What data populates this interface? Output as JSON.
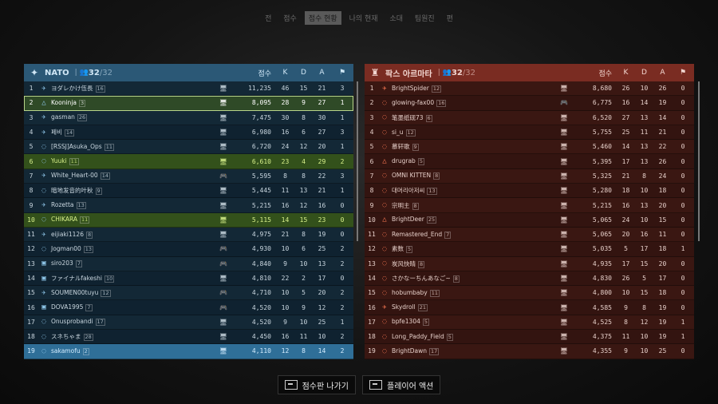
{
  "topnav": [
    "전",
    "점수",
    "점수 현황",
    "나의 현재",
    "소대",
    "팀원진",
    "편"
  ],
  "topnav_active": 2,
  "columns": {
    "score": "점수",
    "k": "K",
    "d": "D",
    "a": "A",
    "flag": "⚑"
  },
  "nato": {
    "name": "NATO",
    "count": "32",
    "max": "/32",
    "players": [
      {
        "idx": "1",
        "cls": "✈",
        "name": "ヨダレかけ伍長",
        "lvl": "16",
        "plat": "pc",
        "score": "11,235",
        "k": "46",
        "d": "15",
        "a": "21",
        "flag": "3"
      },
      {
        "idx": "2",
        "cls": "△",
        "name": "Kooninja",
        "lvl": "3",
        "plat": "pc",
        "score": "8,095",
        "k": "28",
        "d": "9",
        "a": "27",
        "flag": "1",
        "state": "me"
      },
      {
        "idx": "3",
        "cls": "✈",
        "name": "gasman",
        "lvl": "26",
        "plat": "pc",
        "score": "7,475",
        "k": "30",
        "d": "8",
        "a": "30",
        "flag": "1"
      },
      {
        "idx": "4",
        "cls": "✈",
        "name": "페비",
        "lvl": "14",
        "plat": "pc",
        "score": "6,980",
        "k": "16",
        "d": "6",
        "a": "27",
        "flag": "3"
      },
      {
        "idx": "5",
        "cls": "◌",
        "name": "[RSSJ]Asuka_Ops",
        "lvl": "11",
        "plat": "pc",
        "score": "6,720",
        "k": "24",
        "d": "12",
        "a": "20",
        "flag": "1"
      },
      {
        "idx": "6",
        "cls": "◌",
        "name": "Yuuki",
        "lvl": "11",
        "plat": "pc",
        "score": "6,610",
        "k": "23",
        "d": "4",
        "a": "29",
        "flag": "2",
        "state": "squad"
      },
      {
        "idx": "7",
        "cls": "✈",
        "name": "White_Heart-00",
        "lvl": "14",
        "plat": "pad",
        "score": "5,595",
        "k": "8",
        "d": "8",
        "a": "22",
        "flag": "3"
      },
      {
        "idx": "8",
        "cls": "◌",
        "name": "暗地发音的叶秋",
        "lvl": "9",
        "plat": "pc",
        "score": "5,445",
        "k": "11",
        "d": "13",
        "a": "21",
        "flag": "1"
      },
      {
        "idx": "9",
        "cls": "✈",
        "name": "Rozetta",
        "lvl": "13",
        "plat": "pc",
        "score": "5,215",
        "k": "16",
        "d": "12",
        "a": "16",
        "flag": "0"
      },
      {
        "idx": "10",
        "cls": "◌",
        "name": "CHIKARA",
        "lvl": "11",
        "plat": "pc",
        "score": "5,115",
        "k": "14",
        "d": "15",
        "a": "23",
        "flag": "0",
        "state": "squad"
      },
      {
        "idx": "11",
        "cls": "✈",
        "name": "eijiaki1126",
        "lvl": "8",
        "plat": "pc",
        "score": "4,975",
        "k": "21",
        "d": "8",
        "a": "19",
        "flag": "0"
      },
      {
        "idx": "12",
        "cls": "◌",
        "name": "Jogman00",
        "lvl": "13",
        "plat": "pad",
        "score": "4,930",
        "k": "10",
        "d": "6",
        "a": "25",
        "flag": "2"
      },
      {
        "idx": "13",
        "cls": "▣",
        "name": "siro203",
        "lvl": "7",
        "plat": "pad",
        "score": "4,840",
        "k": "9",
        "d": "10",
        "a": "13",
        "flag": "2"
      },
      {
        "idx": "14",
        "cls": "▣",
        "name": "ファイナルfakeshi",
        "lvl": "10",
        "plat": "pc",
        "score": "4,810",
        "k": "22",
        "d": "2",
        "a": "17",
        "flag": "0"
      },
      {
        "idx": "15",
        "cls": "✈",
        "name": "SOUMEN00tuyu",
        "lvl": "12",
        "plat": "pad",
        "score": "4,710",
        "k": "10",
        "d": "5",
        "a": "20",
        "flag": "2"
      },
      {
        "idx": "16",
        "cls": "▣",
        "name": "DOVA1995",
        "lvl": "7",
        "plat": "pad",
        "score": "4,520",
        "k": "10",
        "d": "9",
        "a": "12",
        "flag": "2"
      },
      {
        "idx": "17",
        "cls": "◌",
        "name": "Onusprobandi",
        "lvl": "17",
        "plat": "pc",
        "score": "4,520",
        "k": "9",
        "d": "10",
        "a": "25",
        "flag": "1"
      },
      {
        "idx": "18",
        "cls": "◌",
        "name": "スネちゃま",
        "lvl": "28",
        "plat": "pc",
        "score": "4,450",
        "k": "16",
        "d": "11",
        "a": "10",
        "flag": "2"
      },
      {
        "idx": "19",
        "cls": "◌",
        "name": "sakamofu",
        "lvl": "2",
        "plat": "pc",
        "score": "4,110",
        "k": "12",
        "d": "8",
        "a": "14",
        "flag": "2",
        "state": "hl"
      }
    ]
  },
  "pax": {
    "name": "팍스 아르마타",
    "count": "32",
    "max": "/32",
    "players": [
      {
        "idx": "1",
        "cls": "✈",
        "name": "BrightSpider",
        "lvl": "12",
        "plat": "pc",
        "score": "8,680",
        "k": "26",
        "d": "10",
        "a": "26",
        "flag": "0"
      },
      {
        "idx": "2",
        "cls": "◌",
        "name": "glowing-fax00",
        "lvl": "16",
        "plat": "pad",
        "score": "6,775",
        "k": "16",
        "d": "14",
        "a": "19",
        "flag": "0"
      },
      {
        "idx": "3",
        "cls": "◌",
        "name": "笔墨纸砚73",
        "lvl": "6",
        "plat": "pc",
        "score": "6,520",
        "k": "27",
        "d": "13",
        "a": "14",
        "flag": "0"
      },
      {
        "idx": "4",
        "cls": "◌",
        "name": "si_u",
        "lvl": "12",
        "plat": "pc",
        "score": "5,755",
        "k": "25",
        "d": "11",
        "a": "21",
        "flag": "0"
      },
      {
        "idx": "5",
        "cls": "◌",
        "name": "慕轩歌",
        "lvl": "9",
        "plat": "pc",
        "score": "5,460",
        "k": "14",
        "d": "13",
        "a": "22",
        "flag": "0"
      },
      {
        "idx": "6",
        "cls": "△",
        "name": "drugrab",
        "lvl": "5",
        "plat": "pc",
        "score": "5,395",
        "k": "17",
        "d": "13",
        "a": "26",
        "flag": "0"
      },
      {
        "idx": "7",
        "cls": "◌",
        "name": "OMNI KITTEN",
        "lvl": "8",
        "plat": "pc",
        "score": "5,325",
        "k": "21",
        "d": "8",
        "a": "24",
        "flag": "0"
      },
      {
        "idx": "8",
        "cls": "◌",
        "name": "대머리아저씨",
        "lvl": "13",
        "plat": "pc",
        "score": "5,280",
        "k": "18",
        "d": "10",
        "a": "18",
        "flag": "0"
      },
      {
        "idx": "9",
        "cls": "◌",
        "name": "宗明主",
        "lvl": "8",
        "plat": "pc",
        "score": "5,215",
        "k": "16",
        "d": "13",
        "a": "20",
        "flag": "0"
      },
      {
        "idx": "10",
        "cls": "△",
        "name": "BrightDeer",
        "lvl": "25",
        "plat": "pc",
        "score": "5,065",
        "k": "24",
        "d": "10",
        "a": "15",
        "flag": "0"
      },
      {
        "idx": "11",
        "cls": "◌",
        "name": "Remastered_End",
        "lvl": "7",
        "plat": "pc",
        "score": "5,065",
        "k": "20",
        "d": "16",
        "a": "11",
        "flag": "0"
      },
      {
        "idx": "12",
        "cls": "◌",
        "name": "素数",
        "lvl": "5",
        "plat": "pc",
        "score": "5,035",
        "k": "5",
        "d": "17",
        "a": "18",
        "flag": "1"
      },
      {
        "idx": "13",
        "cls": "◌",
        "name": "炭风快晴",
        "lvl": "8",
        "plat": "pc",
        "score": "4,935",
        "k": "17",
        "d": "15",
        "a": "20",
        "flag": "0"
      },
      {
        "idx": "14",
        "cls": "◌",
        "name": "さかなーちんあなご~",
        "lvl": "8",
        "plat": "pc",
        "score": "4,830",
        "k": "26",
        "d": "5",
        "a": "17",
        "flag": "0"
      },
      {
        "idx": "15",
        "cls": "◌",
        "name": "hobumbaby",
        "lvl": "11",
        "plat": "pc",
        "score": "4,800",
        "k": "10",
        "d": "15",
        "a": "18",
        "flag": "0"
      },
      {
        "idx": "16",
        "cls": "✈",
        "name": "Skydroll",
        "lvl": "21",
        "plat": "pc",
        "score": "4,585",
        "k": "9",
        "d": "8",
        "a": "19",
        "flag": "0"
      },
      {
        "idx": "17",
        "cls": "◌",
        "name": "bpfe1304",
        "lvl": "5",
        "plat": "pc",
        "score": "4,525",
        "k": "8",
        "d": "12",
        "a": "19",
        "flag": "1"
      },
      {
        "idx": "18",
        "cls": "◌",
        "name": "Long_Paddy_Field",
        "lvl": "5",
        "plat": "pc",
        "score": "4,375",
        "k": "11",
        "d": "10",
        "a": "19",
        "flag": "1"
      },
      {
        "idx": "19",
        "cls": "◌",
        "name": "BrightDawn",
        "lvl": "17",
        "plat": "pc",
        "score": "4,355",
        "k": "9",
        "d": "10",
        "a": "25",
        "flag": "0"
      }
    ]
  },
  "footer": {
    "exit_label": "점수판 나가기",
    "actions_label": "플레이어 액션"
  }
}
